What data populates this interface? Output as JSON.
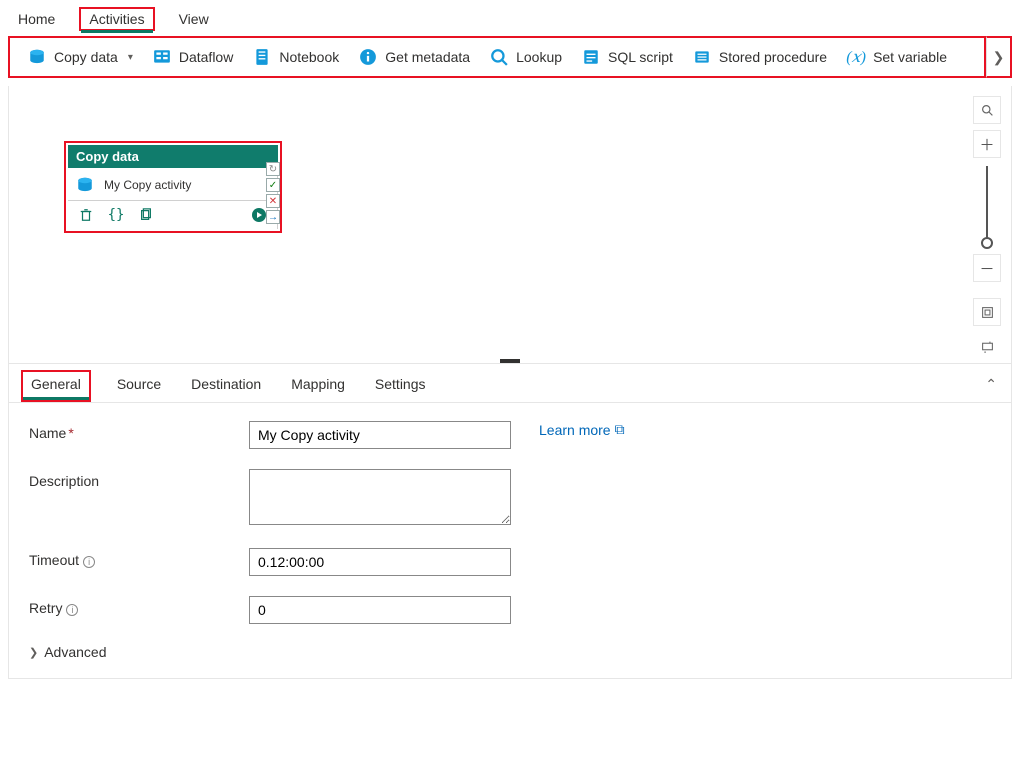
{
  "topTabs": {
    "home": "Home",
    "activities": "Activities",
    "view": "View"
  },
  "toolbar": {
    "copyData": "Copy data",
    "dataflow": "Dataflow",
    "notebook": "Notebook",
    "getMetadata": "Get metadata",
    "lookup": "Lookup",
    "sqlScript": "SQL script",
    "storedProc": "Stored procedure",
    "setVariable": "Set variable"
  },
  "canvas": {
    "cardTitle": "Copy data",
    "activityName": "My Copy activity"
  },
  "propsTabs": {
    "general": "General",
    "source": "Source",
    "destination": "Destination",
    "mapping": "Mapping",
    "settings": "Settings"
  },
  "form": {
    "nameLabel": "Name",
    "nameValue": "My Copy activity",
    "learnMore": "Learn more",
    "descLabel": "Description",
    "descValue": "",
    "timeoutLabel": "Timeout",
    "timeoutValue": "0.12:00:00",
    "retryLabel": "Retry",
    "retryValue": "0",
    "advanced": "Advanced"
  }
}
